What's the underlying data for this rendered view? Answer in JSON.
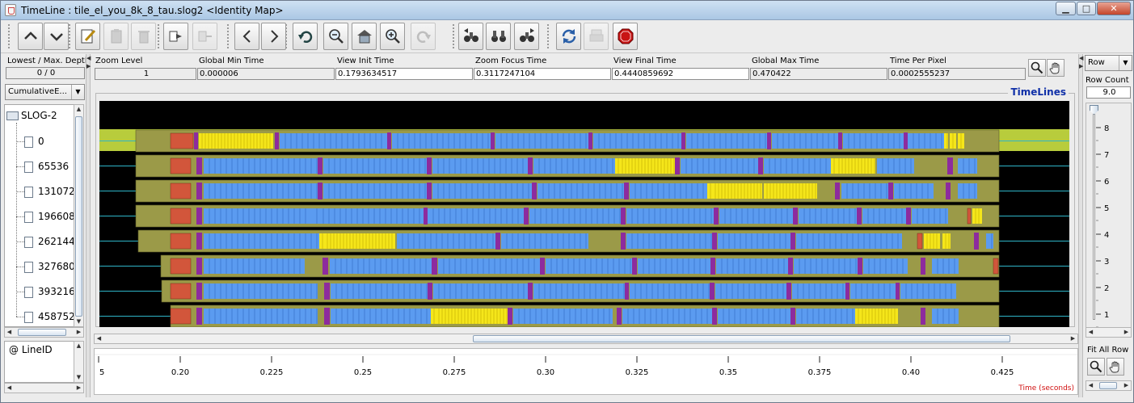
{
  "window": {
    "title": "TimeLine : tile_el_you_8k_8_tau.slog2  <Identity Map>",
    "controls": [
      "minimize",
      "maximize",
      "close"
    ]
  },
  "toolbar": {
    "buttons": [
      {
        "name": "up",
        "icon": "chevron-up-icon",
        "enabled": true
      },
      {
        "name": "down",
        "icon": "chevron-down-icon",
        "enabled": true
      },
      {
        "name": "edit",
        "icon": "edit-icon",
        "enabled": true
      },
      {
        "name": "paste",
        "icon": "clipboard-icon",
        "enabled": false
      },
      {
        "name": "delete",
        "icon": "trash-icon",
        "enabled": false
      },
      {
        "name": "expand",
        "icon": "expand-icon",
        "enabled": true
      },
      {
        "name": "collapse",
        "icon": "collapse-icon",
        "enabled": false
      },
      {
        "name": "backward",
        "icon": "arrow-left-icon",
        "enabled": true
      },
      {
        "name": "forward",
        "icon": "arrow-right-icon",
        "enabled": true
      },
      {
        "name": "undo",
        "icon": "undo-icon",
        "enabled": true
      },
      {
        "name": "zoom-out",
        "icon": "zoom-out-icon",
        "enabled": true
      },
      {
        "name": "home",
        "icon": "home-icon",
        "enabled": true
      },
      {
        "name": "zoom-in",
        "icon": "zoom-in-icon",
        "enabled": true
      },
      {
        "name": "redo",
        "icon": "redo-icon",
        "enabled": false
      },
      {
        "name": "search-backward",
        "icon": "binoculars-back-icon",
        "enabled": true
      },
      {
        "name": "search",
        "icon": "binoculars-icon",
        "enabled": true
      },
      {
        "name": "search-forward",
        "icon": "binoculars-forward-icon",
        "enabled": true
      },
      {
        "name": "refresh",
        "icon": "refresh-icon",
        "enabled": true
      },
      {
        "name": "print",
        "icon": "print-icon",
        "enabled": false
      },
      {
        "name": "stop",
        "icon": "stop-icon",
        "enabled": true
      }
    ]
  },
  "info": {
    "depth_label": "Lowest / Max. Depth",
    "depth_value": "0 / 0",
    "view_mode": "CumulativeE...",
    "zoom_level_label": "Zoom Level",
    "zoom_level": "1",
    "global_min_label": "Global Min Time",
    "global_min": "0.000006",
    "view_init_label": "View  Init Time",
    "view_init": "0.1793634517",
    "zoom_focus_label": "Zoom Focus Time",
    "zoom_focus": "0.3117247104",
    "view_final_label": "View Final Time",
    "view_final": "0.4440859692",
    "global_max_label": "Global Max Time",
    "global_max": "0.470422",
    "time_per_pixel_label": "Time Per Pixel",
    "time_per_pixel": "0.0002555237"
  },
  "tree": {
    "root": "SLOG-2",
    "items": [
      "0",
      "65536",
      "131072",
      "196608",
      "262144",
      "327680",
      "393216",
      "458752"
    ]
  },
  "lower_left": {
    "label": "@ LineID"
  },
  "canvas": {
    "title": "TimeLines"
  },
  "ruler": {
    "ticks": [
      "5",
      "0.20",
      "0.225",
      "0.25",
      "0.275",
      "0.30",
      "0.325",
      "0.35",
      "0.375",
      "0.40",
      "0.425"
    ],
    "axis_label": "Time (seconds)"
  },
  "right": {
    "row_mode": "Row",
    "row_count_label": "Row Count",
    "row_count": "9.0",
    "slider_ticks": [
      "8",
      "7",
      "6",
      "5",
      "4",
      "3",
      "2",
      "1"
    ],
    "fit_label": "Fit All Row"
  },
  "colors": {
    "background": "#000000",
    "highlight_row": "#b8cc3c",
    "state_bg": "#9b9a48",
    "compute": "#5b9bf0",
    "mpi_sync": "#f5e61a",
    "marker": "#8d2b9e",
    "init": "#d2563b",
    "timeline_line": "#2fb5c8"
  }
}
